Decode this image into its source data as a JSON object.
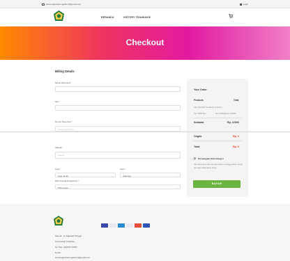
{
  "topbar": {
    "email": "kemenagkotasungaibumi@gmail.com",
    "login_label": "Login"
  },
  "nav": {
    "links": [
      "BERANDA",
      "HISTORY TRANSAKSI"
    ]
  },
  "hero": {
    "title": "Checkout"
  },
  "billing": {
    "title": "Billing Details",
    "fields": [
      {
        "label": "Nama Penerima *",
        "placeholder": ""
      },
      {
        "label": "Nip *",
        "placeholder": ""
      },
      {
        "label": "Nomor Penerima *",
        "placeholder": "Nomor penerima"
      },
      {
        "label": "Alamat *",
        "placeholder": "Alamat"
      }
    ],
    "kota_label": "Kota *",
    "kota_value": "Kota Jambi",
    "kurir_label": "Kurir *",
    "kurir_value": "JNE Reg",
    "pilih_label": "Pilih Tempat Pengiriman *",
    "pilih_value": "Pilih Kantor"
  },
  "order": {
    "title": "Your Order",
    "col_products": "Products",
    "col_total": "Total",
    "product_name": "Tas Sekolah Sanatmu ui beton",
    "product_qty": "Tas SMP Bro",
    "product_price": "Rp.12000@x1=12000",
    "subtotal_label": "Subtotal",
    "subtotal_value": "Rp. 12000",
    "ongkir_label": "Ongkir",
    "ongkir_value": "Rp. 0",
    "total_label": "Total",
    "total_value": "Rp. 0",
    "checkbox_label": "Persetujuan Kirim Kargo?",
    "note": "Jika Dicentang barang akan dikirim menggunakan kargo dan akan dikenakan biaya",
    "pay_button": "BAYAR"
  },
  "footer": {
    "address": "Alamat : Jl. Rajawali Pringgo",
    "city": "Kecamatan Kotabaru",
    "phone": "No Telp: (0)(0)54 62986",
    "email_label": "Email:",
    "email": "kemenagkotasungaibumi@gmail.com"
  },
  "colors": {
    "accent": "#6cb43f",
    "price_red": "#e32222",
    "hero_gradient": [
      "#ff8a00",
      "#f0345f",
      "#e21aa0",
      "#f080c8"
    ]
  },
  "icons": [
    "envelope-icon",
    "login-icon",
    "cart-icon",
    "logo-icon",
    "payment-card-icon"
  ]
}
